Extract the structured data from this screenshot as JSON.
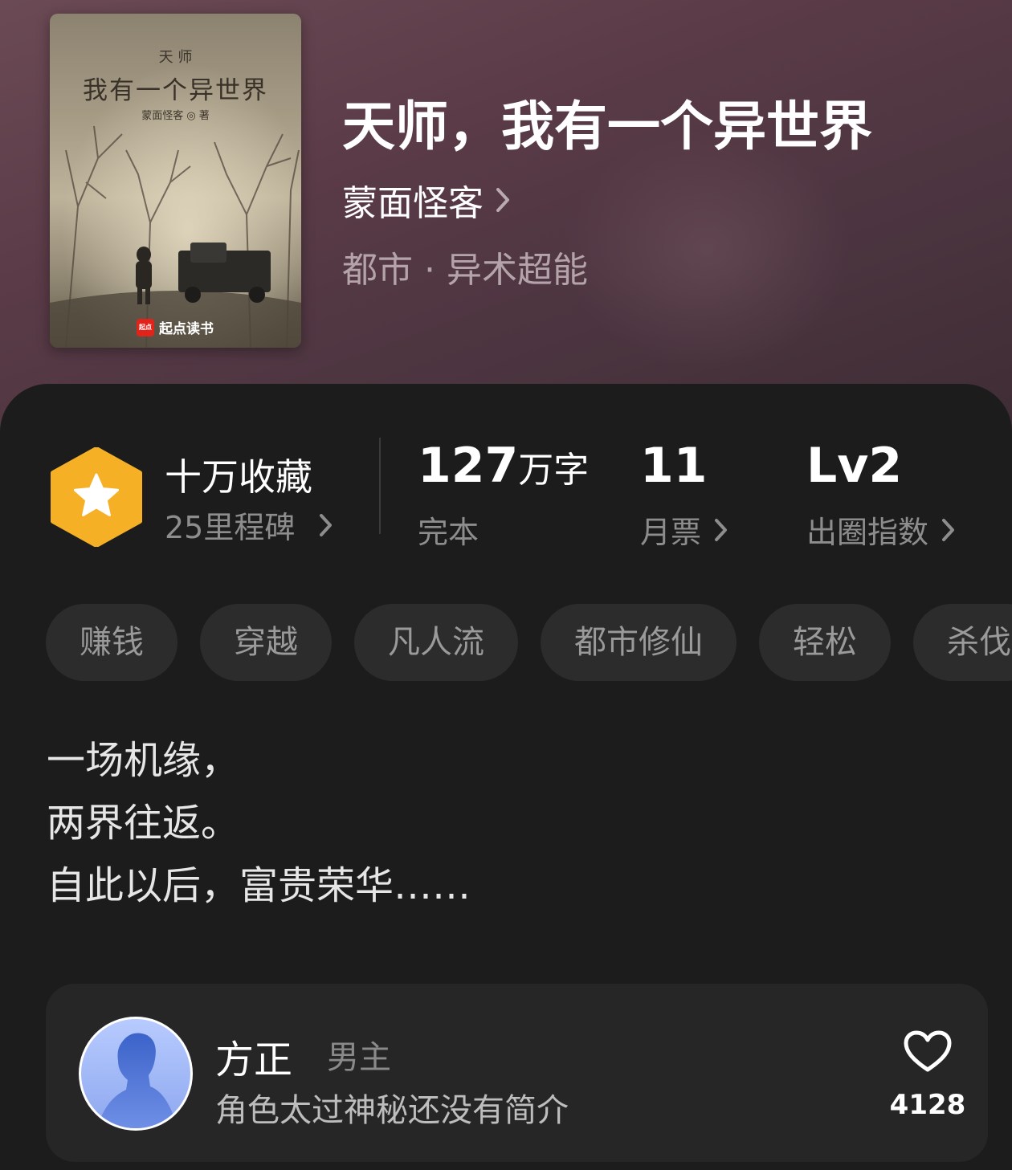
{
  "book": {
    "title": "天师，我有一个异世界",
    "author": "蒙面怪客",
    "genre": "都市 · 异术超能",
    "cover": {
      "seal": "天 师",
      "title": "我有一个异世界",
      "author": "蒙面怪客 ◎ 著",
      "brand": "起点读书",
      "brand_logo": "起点"
    }
  },
  "stats": {
    "collection": {
      "label": "十万收藏",
      "sub": "25里程碑"
    },
    "words": {
      "value": "127",
      "unit": "万字",
      "sub": "完本"
    },
    "tickets": {
      "value": "11",
      "sub": "月票"
    },
    "index": {
      "value": "Lv2",
      "sub": "出圈指数"
    }
  },
  "tags": [
    "赚钱",
    "穿越",
    "凡人流",
    "都市修仙",
    "轻松",
    "杀伐"
  ],
  "description": [
    "一场机缘，",
    "两界往返。",
    "自此以后，富贵荣华……"
  ],
  "character": {
    "name": "方正",
    "role": "男主",
    "desc": "角色太过神秘还没有简介",
    "likes": "4128"
  },
  "colors": {
    "badge": "#f5b026",
    "hero_bg": "#5a3b47",
    "panel_bg": "#1c1c1c",
    "tag_bg": "#2c2c2c"
  },
  "icons": [
    "star-badge-icon",
    "chevron-right-icon",
    "heart-icon",
    "avatar-silhouette-icon"
  ]
}
